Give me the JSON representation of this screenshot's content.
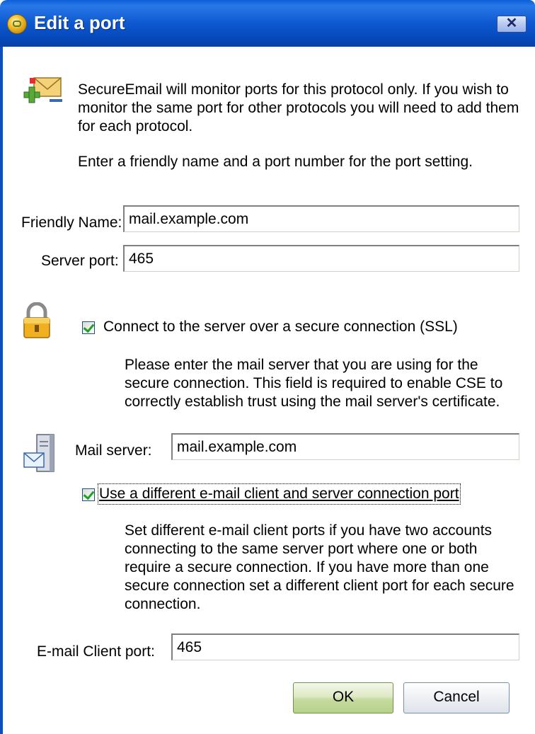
{
  "window": {
    "title": "Edit a port",
    "close_glyph": "✕"
  },
  "intro": {
    "paragraph1": "SecureEmail will monitor ports for this protocol only.  If you wish to monitor the same port for other protocols you will need to add them for each protocol.",
    "paragraph2": "Enter a friendly name and a port number for the port setting."
  },
  "fields": {
    "friendly_name_label": "Friendly Name:",
    "friendly_name_value": "mail.example.com",
    "server_port_label": "Server port:",
    "server_port_value": "465"
  },
  "ssl": {
    "checkbox_label": "Connect to the server over a secure connection (SSL)",
    "checked": true,
    "description": "Please enter the mail server that you are using for the secure connection.  This field is required to enable CSE to correctly establish trust using the mail server's certificate."
  },
  "mail_server": {
    "label": "Mail server:",
    "value": "mail.example.com"
  },
  "client_port_option": {
    "checkbox_label": "Use a different e-mail client and server connection port",
    "checked": true,
    "description": "Set different e-mail client ports if you have two accounts connecting to the same server port where one or both require a secure connection. If you have more than one secure connection set a different client port for each secure connection."
  },
  "client_port": {
    "label": "E-mail Client port:",
    "value": "465"
  },
  "buttons": {
    "ok": "OK",
    "cancel": "Cancel"
  },
  "icons": {
    "title": "app-badge-icon",
    "intro": "add-email-icon",
    "ssl": "padlock-icon",
    "mail_server": "mail-server-icon"
  }
}
